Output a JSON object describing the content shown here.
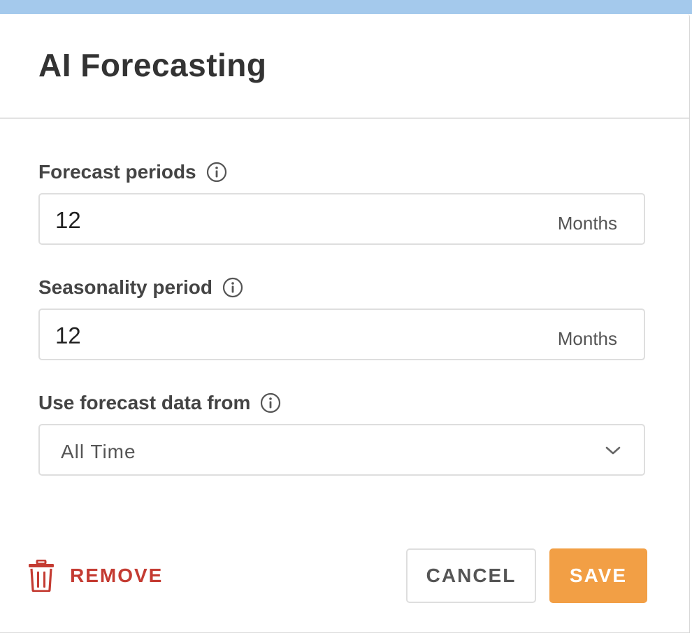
{
  "dialog": {
    "title": "AI Forecasting"
  },
  "fields": {
    "forecast_periods": {
      "label": "Forecast periods",
      "value": "12",
      "suffix": "Months",
      "icon": "info-icon"
    },
    "seasonality_period": {
      "label": "Seasonality period",
      "value": "12",
      "suffix": "Months",
      "icon": "info-icon"
    },
    "forecast_data_from": {
      "label": "Use forecast data from",
      "selected": "All Time",
      "icon": "info-icon"
    }
  },
  "actions": {
    "remove_label": "REMOVE",
    "remove_icon": "trash-icon",
    "cancel_label": "CANCEL",
    "save_label": "SAVE"
  },
  "colors": {
    "top_strip": "#a4c9ec",
    "save_button": "#f29f45",
    "remove": "#c43b32",
    "title": "#333333"
  }
}
